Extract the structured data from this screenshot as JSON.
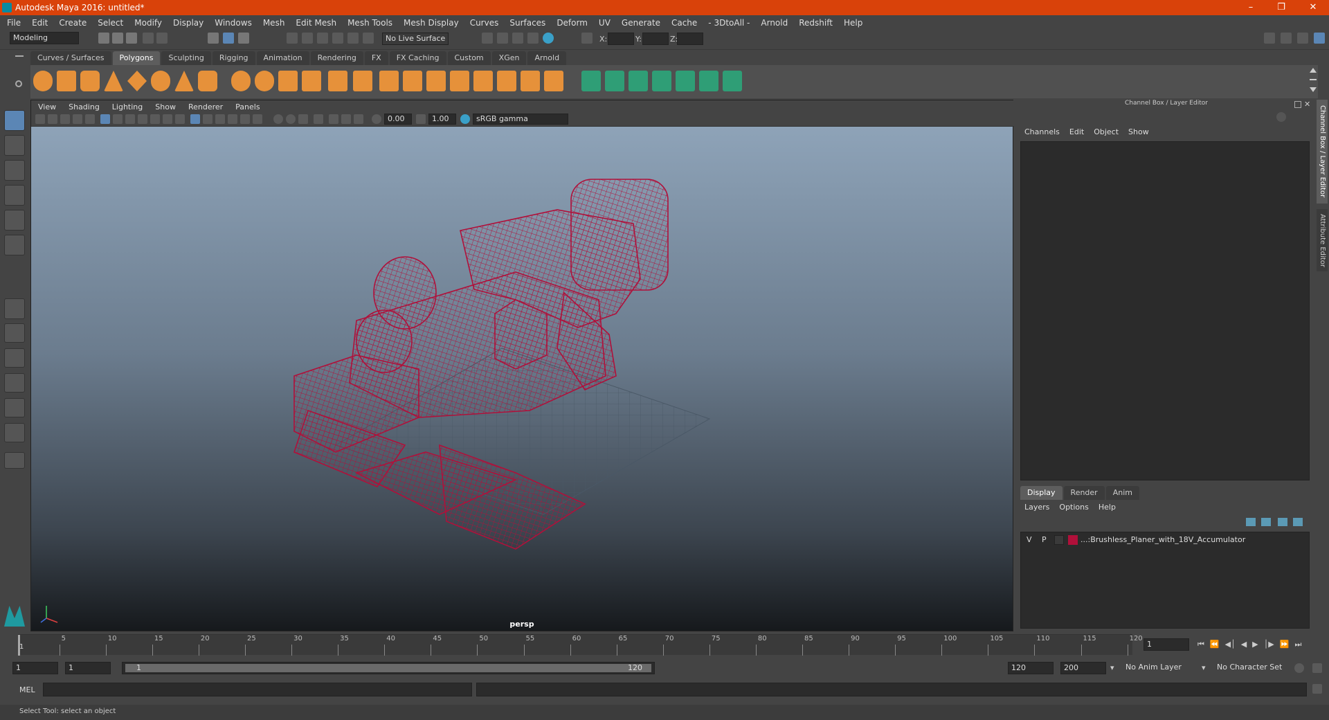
{
  "window": {
    "title": "Autodesk Maya 2016: untitled*"
  },
  "menubar": [
    "File",
    "Edit",
    "Create",
    "Select",
    "Modify",
    "Display",
    "Windows",
    "Mesh",
    "Edit Mesh",
    "Mesh Tools",
    "Mesh Display",
    "Curves",
    "Surfaces",
    "Deform",
    "UV",
    "Generate",
    "Cache",
    "- 3DtoAll -",
    "Arnold",
    "Redshift",
    "Help"
  ],
  "statusline": {
    "mode": "Modeling",
    "live_surface": "No Live Surface",
    "x_label": "X:",
    "y_label": "Y:",
    "z_label": "Z:"
  },
  "shelf_tabs": [
    "Curves / Surfaces",
    "Polygons",
    "Sculpting",
    "Rigging",
    "Animation",
    "Rendering",
    "FX",
    "FX Caching",
    "Custom",
    "XGen",
    "Arnold"
  ],
  "active_shelf_tab": "Polygons",
  "viewport": {
    "menu": [
      "View",
      "Shading",
      "Lighting",
      "Show",
      "Renderer",
      "Panels"
    ],
    "exposure": "0.00",
    "gamma": "1.00",
    "color_space": "sRGB gamma",
    "camera": "persp"
  },
  "channel_box": {
    "title": "Channel Box / Layer Editor",
    "menu": [
      "Channels",
      "Edit",
      "Object",
      "Show"
    ]
  },
  "layer_editor": {
    "tabs": [
      "Display",
      "Render",
      "Anim"
    ],
    "active_tab": "Display",
    "menu": [
      "Layers",
      "Options",
      "Help"
    ],
    "layers": [
      {
        "v": "V",
        "p": "P",
        "name": "...:Brushless_Planer_with_18V_Accumulator",
        "color": "#b0103a"
      }
    ]
  },
  "side_tabs": [
    "Channel Box / Layer Editor",
    "Attribute Editor"
  ],
  "timeline": {
    "ticks": [
      "5",
      "10",
      "15",
      "20",
      "25",
      "30",
      "35",
      "40",
      "45",
      "50",
      "55",
      "60",
      "65",
      "70",
      "75",
      "80",
      "85",
      "90",
      "95",
      "100",
      "105",
      "110",
      "115",
      "120"
    ],
    "start_marker": "1",
    "current_frame": "1"
  },
  "range": {
    "start": "1",
    "playback_start": "1",
    "slider_start": "1",
    "slider_end": "120",
    "playback_end": "120",
    "end": "200",
    "anim_layer": "No Anim Layer",
    "character_set": "No Character Set"
  },
  "command_line": {
    "label": "MEL"
  },
  "help_line": {
    "text": "Select Tool: select an object"
  },
  "colors": {
    "title_bar": "#d9420a",
    "wireframe": "#b0103a",
    "shelf_icon": "#e6913a",
    "shelf_icon_green": "#2f9e76"
  }
}
